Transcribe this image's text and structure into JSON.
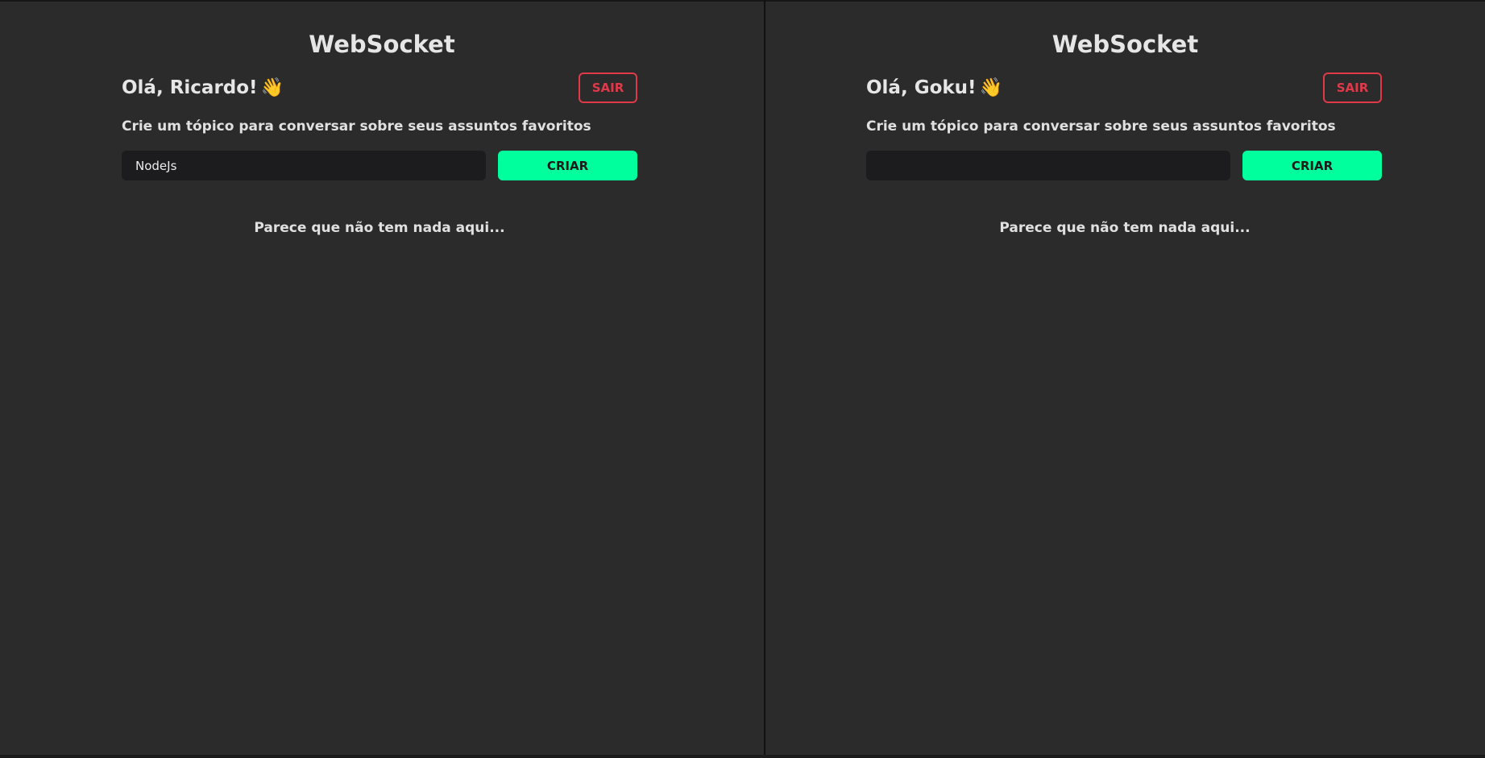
{
  "panels": [
    {
      "title": "WebSocket",
      "greeting": "Olá, Ricardo!",
      "wave_emoji": "👋",
      "logout_label": "SAIR",
      "subtitle": "Crie um tópico para conversar sobre seus assuntos favoritos",
      "topic_input_value": "NodeJs",
      "topic_input_placeholder": "",
      "create_label": "CRIAR",
      "empty_message": "Parece que não tem nada aqui..."
    },
    {
      "title": "WebSocket",
      "greeting": "Olá, Goku!",
      "wave_emoji": "👋",
      "logout_label": "SAIR",
      "subtitle": "Crie um tópico para conversar sobre seus assuntos favoritos",
      "topic_input_value": "",
      "topic_input_placeholder": "",
      "create_label": "CRIAR",
      "empty_message": "Parece que não tem nada aqui..."
    }
  ],
  "colors": {
    "background": "#2b2b2b",
    "accent": "#00ff9d",
    "danger": "#e0394a",
    "input_background": "#1c1b1e",
    "text": "#e6e6e6"
  },
  "icons": {
    "wave": "waving-hand-icon"
  }
}
